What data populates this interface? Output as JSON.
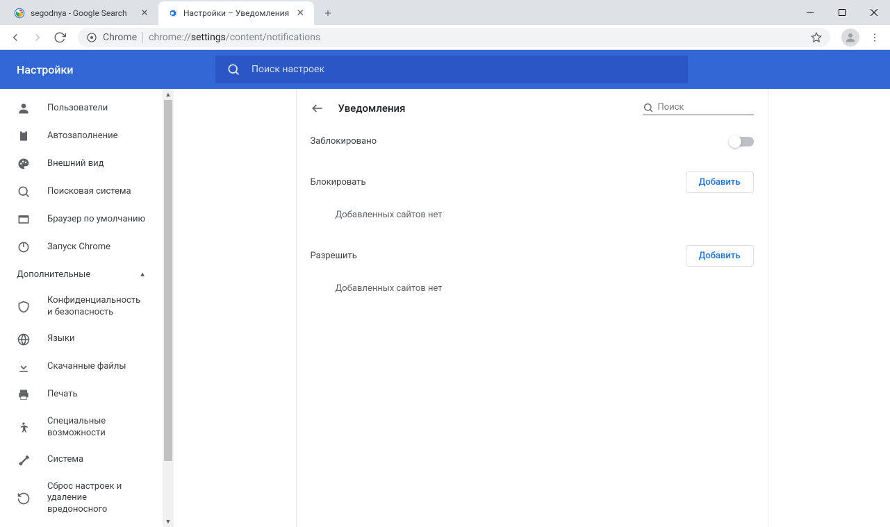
{
  "tabs": [
    {
      "title": "segodnya - Google Search"
    },
    {
      "title": "Настройки – Уведомления"
    }
  ],
  "omnibox": {
    "chrome_label": "Chrome",
    "url_prefix": "chrome://",
    "url_bold": "settings",
    "url_suffix": "/content/notifications"
  },
  "header": {
    "title": "Настройки",
    "search_placeholder": "Поиск настроек"
  },
  "sidebar": {
    "items": [
      {
        "label": "Пользователи"
      },
      {
        "label": "Автозаполнение"
      },
      {
        "label": "Внешний вид"
      },
      {
        "label": "Поисковая система"
      },
      {
        "label": "Браузер по умолчанию"
      },
      {
        "label": "Запуск Chrome"
      }
    ],
    "section_label": "Дополнительные",
    "advanced": [
      {
        "label": "Конфиденциальность и безопасность"
      },
      {
        "label": "Языки"
      },
      {
        "label": "Скачанные файлы"
      },
      {
        "label": "Печать"
      },
      {
        "label": "Специальные возможности"
      },
      {
        "label": "Система"
      },
      {
        "label": "Сброс настроек и удаление вредоносного"
      }
    ]
  },
  "main": {
    "page_title": "Уведомления",
    "search_placeholder": "Поиск",
    "blocked_label": "Заблокировано",
    "block_section": "Блокировать",
    "allow_section": "Разрешить",
    "add_button": "Добавить",
    "empty_text": "Добавленных сайтов нет"
  }
}
